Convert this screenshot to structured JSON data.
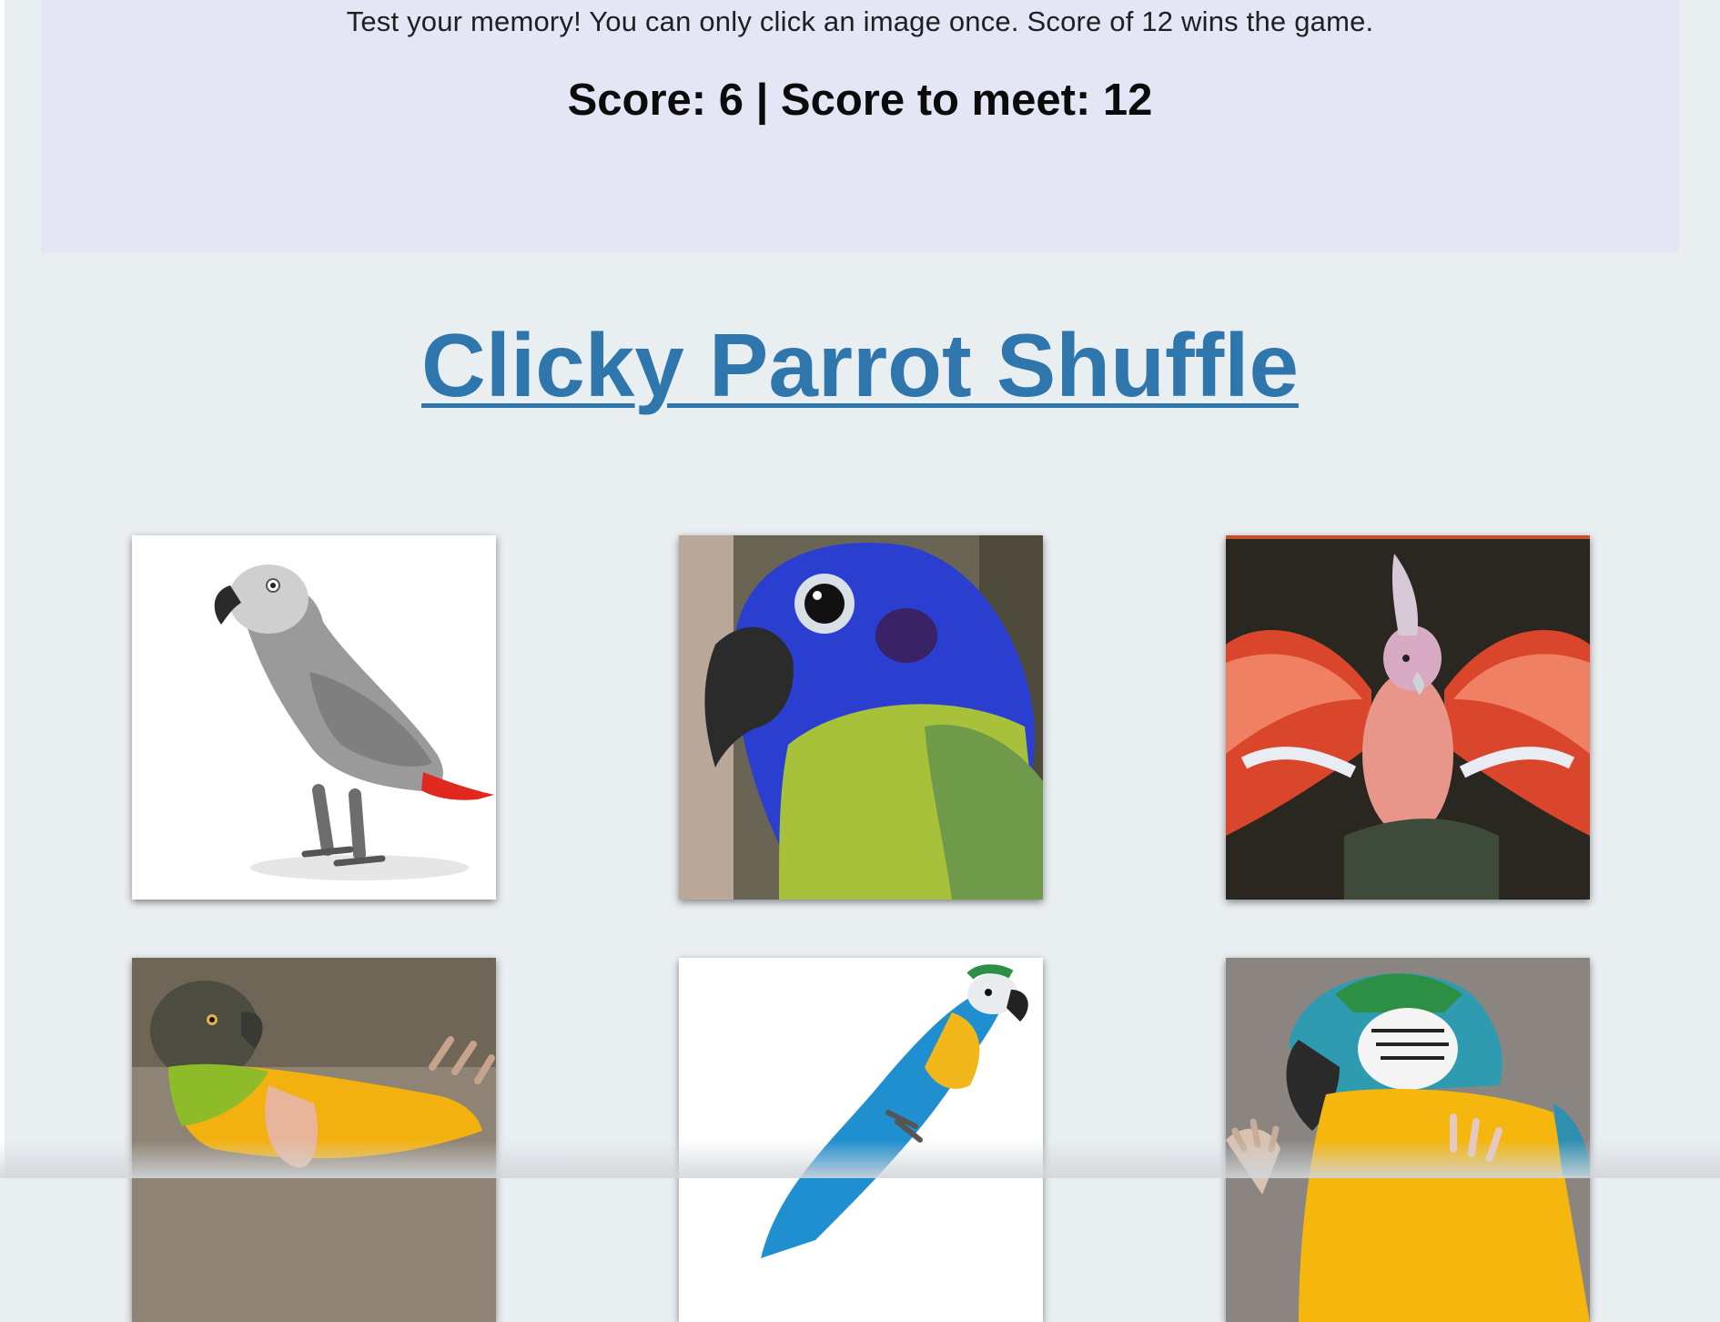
{
  "header": {
    "instructions": "Test your memory! You can only click an image once. Score of 12 wins the game.",
    "score_text": "Score: 6 | Score to meet: 12"
  },
  "title": "Clicky Parrot Shuffle",
  "colors": {
    "page_bg": "#e9eef1",
    "jumbotron_bg": "#e4e6f6",
    "title_link": "#2f76ad"
  },
  "cards": [
    {
      "subject": "african-grey-parrot"
    },
    {
      "subject": "blue-headed-parrot"
    },
    {
      "subject": "galah-cockatoo"
    },
    {
      "subject": "senegal-parrot"
    },
    {
      "subject": "blue-and-gold-macaw-flying"
    },
    {
      "subject": "blue-and-gold-macaw-closeup"
    }
  ]
}
